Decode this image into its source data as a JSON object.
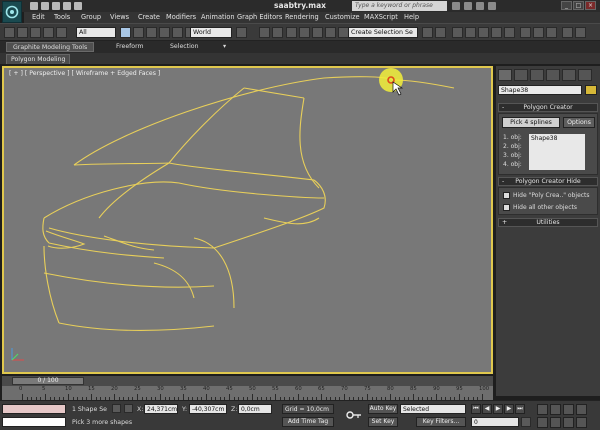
{
  "window": {
    "title": "saabtry.max",
    "help_search_placeholder": "Type a keyword or phrase"
  },
  "menu": [
    "Edit",
    "Tools",
    "Group",
    "Views",
    "Create",
    "Modifiers",
    "Animation",
    "Graph Editors",
    "Rendering",
    "Customize",
    "MAXScript",
    "Help"
  ],
  "toolbar": {
    "selection_filter": "All",
    "coord_system": "World",
    "selection_set": "Create Selection Se"
  },
  "ribbon": {
    "tabs": [
      "Graphite Modeling Tools",
      "Freeform",
      "Selection"
    ],
    "sub_tab": "Polygon Modeling"
  },
  "viewport": {
    "label": "[ + ] [ Perspective ] [ Wireframe + Edged Faces ]",
    "wire_color": "#e8cf5a",
    "highlight_color": "#f2ef3a"
  },
  "command_panel": {
    "object_name": "Shape38",
    "polygon_creator": {
      "title": "Polygon Creator",
      "pick_button": "Pick 4 splines",
      "options_button": "Options",
      "obj_labels": [
        "1. obj:",
        "2. obj:",
        "3. obj:",
        "4. obj:"
      ],
      "obj_list": [
        "Shape38"
      ]
    },
    "polygon_creator_hide": {
      "title": "Polygon Creator Hide",
      "checkbox1": "Hide \"Poly Crea..\" objects",
      "checkbox2": "Hide all other objects"
    },
    "utilities": {
      "title": "Utilities"
    }
  },
  "time": {
    "slider": "0 / 100",
    "ticks": [
      "0",
      "5",
      "10",
      "15",
      "20",
      "25",
      "30",
      "35",
      "40",
      "45",
      "50",
      "55",
      "60",
      "65",
      "70",
      "75",
      "80",
      "85",
      "90",
      "95",
      "100"
    ]
  },
  "status": {
    "selected_count": "1 Shape Se",
    "prompt": "Pick 3 more shapes",
    "x_label": "X:",
    "x_value": "24,371cm",
    "y_label": "Y:",
    "y_value": "-40,307cm",
    "z_label": "Z:",
    "z_value": "0,0cm",
    "grid": "Grid = 10,0cm",
    "add_time_tag": "Add Time Tag",
    "auto_key": "Auto Key",
    "set_key": "Set Key",
    "key_mode": "Selected",
    "key_filters": "Key Filters...",
    "frame": "0"
  }
}
